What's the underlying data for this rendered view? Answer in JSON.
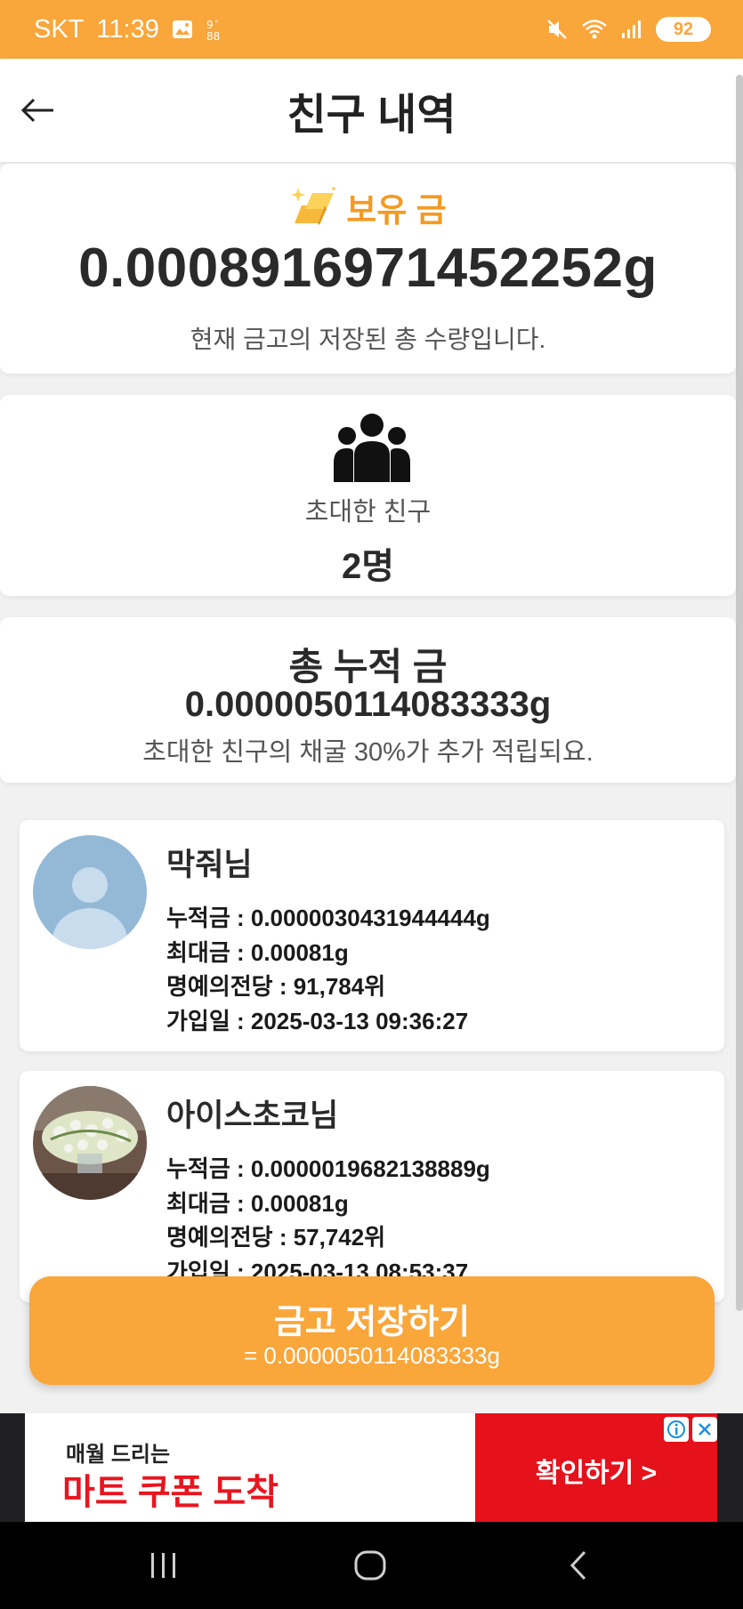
{
  "status_bar": {
    "carrier": "SKT",
    "time": "11:39",
    "battery": "92"
  },
  "header": {
    "title": "친구 내역",
    "back_icon": "arrow-left-icon"
  },
  "balance": {
    "label": "보유 금",
    "amount": "0.000891697145225 2g",
    "description": "현재 금고의 저장된 총 수량입니다."
  },
  "invited": {
    "label": "초대한 친구",
    "count": "2명"
  },
  "total": {
    "title": "총 누적 금",
    "amount": "0.0000050114083333g",
    "description": "초대한 친구의 채굴 30%가 추가 적립되요."
  },
  "friends": [
    {
      "name": "막줘님",
      "accumulated": "누적금 : 0.0000030431944444g",
      "max": "최대금 : 0.00081g",
      "rank": "명예의전당 : 91,784위",
      "joined": "가입일 : 2025-03-13 09:36:27"
    },
    {
      "name": "아이스초코님",
      "accumulated": "누적금 : 0.0000019682138889g",
      "max": "최대금 : 0.00081g",
      "rank": "명예의전당 : 57,742위",
      "joined": "가입일 : 2025-03-13 08:53:37"
    }
  ],
  "save_button": {
    "label": "금고 저장하기",
    "sub": "= 0.0000050114083333g"
  },
  "ad": {
    "small": "매월 드리는",
    "big": "마트 쿠폰 도착",
    "cta": "확인하기 >"
  },
  "colors": {
    "accent": "#f9a63b",
    "gold_text": "#f39a24",
    "ad_red": "#e5111b"
  }
}
